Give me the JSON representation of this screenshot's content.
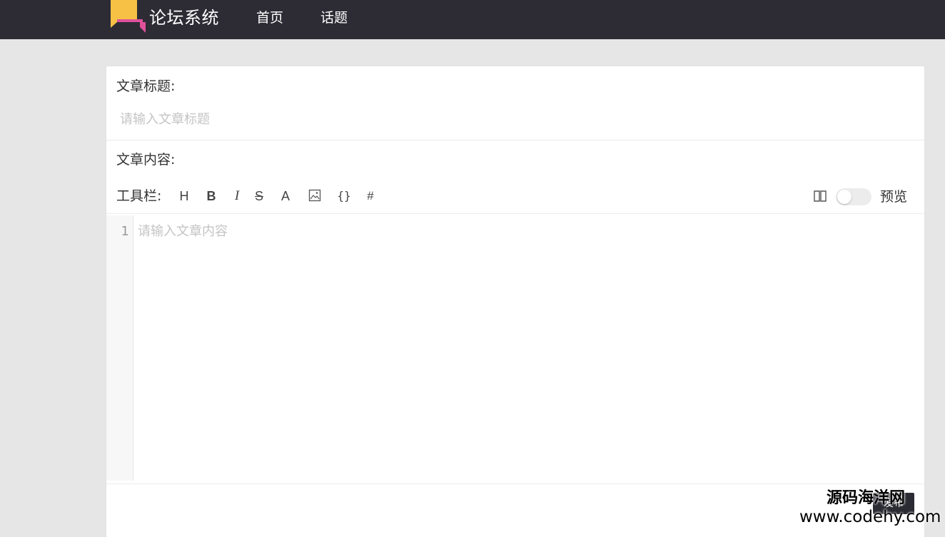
{
  "header": {
    "brand": "论坛系统",
    "nav": [
      {
        "label": "首页"
      },
      {
        "label": "话题"
      }
    ],
    "logo_icon": "chat-bubble-logo"
  },
  "form": {
    "title_label": "文章标题:",
    "title_placeholder": "请输入文章标题",
    "title_value": "",
    "content_label": "文章内容:",
    "content_placeholder": "请输入文章内容",
    "content_value": ""
  },
  "toolbar": {
    "label": "工具栏:",
    "buttons": [
      {
        "glyph": "H",
        "icon": "heading-icon"
      },
      {
        "glyph": "B",
        "icon": "bold-icon"
      },
      {
        "glyph": "I",
        "icon": "italic-icon"
      },
      {
        "glyph": "S",
        "icon": "strikethrough-icon"
      },
      {
        "glyph": "A",
        "icon": "font-color-icon"
      },
      {
        "glyph": "",
        "icon": "image-icon"
      },
      {
        "glyph": "{}",
        "icon": "code-icon"
      },
      {
        "glyph": "#",
        "icon": "hashtag-icon"
      }
    ],
    "preview_icon": "book-icon",
    "preview_enabled": false,
    "preview_label": "预览"
  },
  "editor": {
    "line_numbers": [
      "1"
    ]
  },
  "actions": {
    "publish_label": "发布"
  },
  "watermark": {
    "line1": "源码海洋网",
    "line2": "www.codehy.com"
  },
  "colors": {
    "header_bg": "#2d2c35",
    "page_bg": "#e6e6e6",
    "logo_yellow": "#f6c144",
    "logo_pink": "#e0519a"
  }
}
